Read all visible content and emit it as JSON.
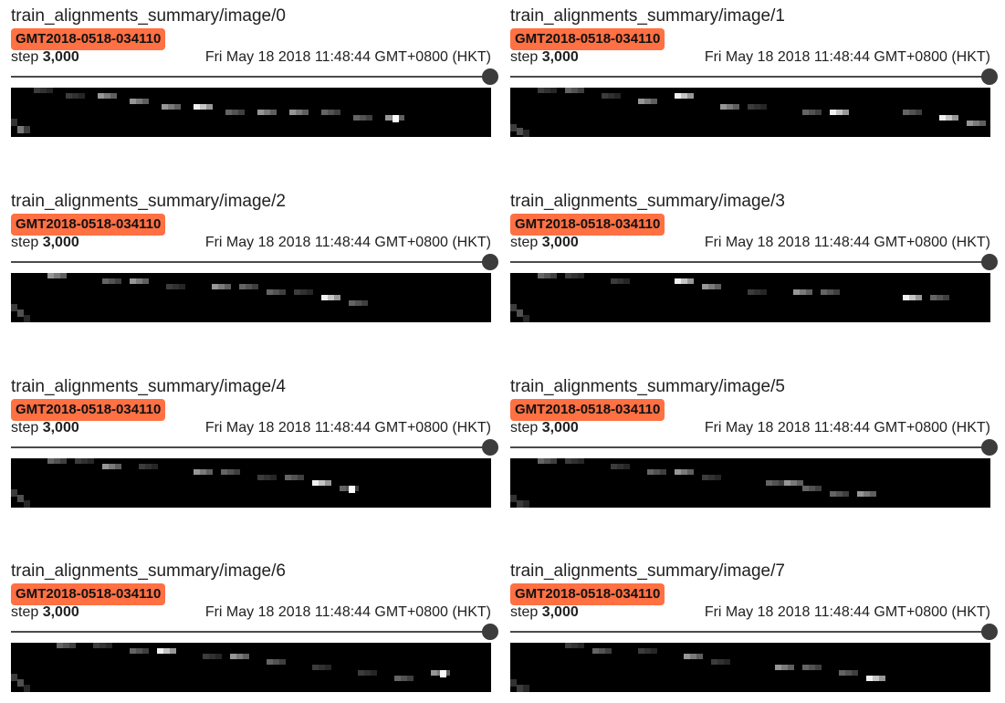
{
  "cards": [
    {
      "title": "train_alignments_summary/image/0",
      "run": "GMT2018-0518-034110",
      "step_label": "step",
      "step_value": "3,000",
      "timestamp": "Fri May 18 2018 11:48:44 GMT+0800 (HKT)"
    },
    {
      "title": "train_alignments_summary/image/1",
      "run": "GMT2018-0518-034110",
      "step_label": "step",
      "step_value": "3,000",
      "timestamp": "Fri May 18 2018 11:48:44 GMT+0800 (HKT)"
    },
    {
      "title": "train_alignments_summary/image/2",
      "run": "GMT2018-0518-034110",
      "step_label": "step",
      "step_value": "3,000",
      "timestamp": "Fri May 18 2018 11:48:44 GMT+0800 (HKT)"
    },
    {
      "title": "train_alignments_summary/image/3",
      "run": "GMT2018-0518-034110",
      "step_label": "step",
      "step_value": "3,000",
      "timestamp": "Fri May 18 2018 11:48:44 GMT+0800 (HKT)"
    },
    {
      "title": "train_alignments_summary/image/4",
      "run": "GMT2018-0518-034110",
      "step_label": "step",
      "step_value": "3,000",
      "timestamp": "Fri May 18 2018 11:48:44 GMT+0800 (HKT)"
    },
    {
      "title": "train_alignments_summary/image/5",
      "run": "GMT2018-0518-034110",
      "step_label": "step",
      "step_value": "3,000",
      "timestamp": "Fri May 18 2018 11:48:44 GMT+0800 (HKT)"
    },
    {
      "title": "train_alignments_summary/image/6",
      "run": "GMT2018-0518-034110",
      "step_label": "step",
      "step_value": "3,000",
      "timestamp": "Fri May 18 2018 11:48:44 GMT+0800 (HKT)"
    },
    {
      "title": "train_alignments_summary/image/7",
      "run": "GMT2018-0518-034110",
      "step_label": "step",
      "step_value": "3,000",
      "timestamp": "Fri May 18 2018 11:48:44 GMT+0800 (HKT)"
    }
  ],
  "colors": {
    "run_badge": "#ff7043",
    "slider": "#3c3c3c",
    "image_background": "#000000"
  },
  "step_slider": {
    "position": 1.0
  }
}
